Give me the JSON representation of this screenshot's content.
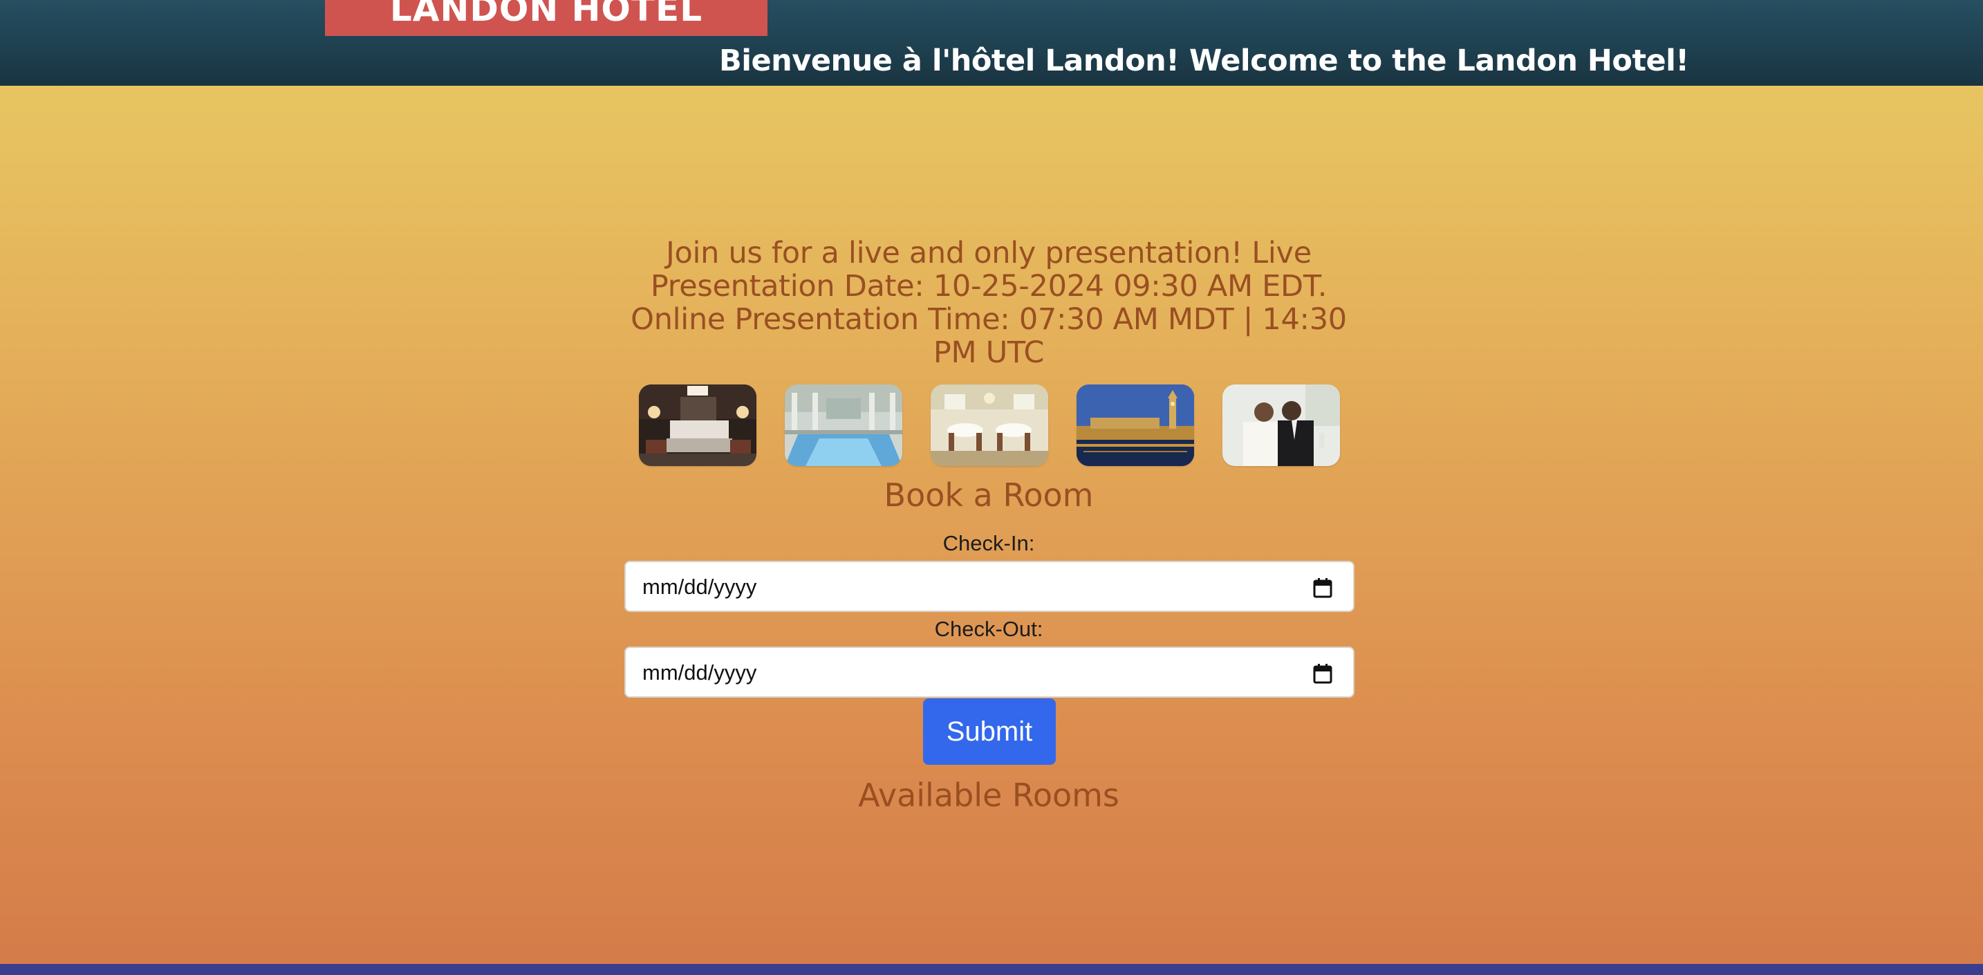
{
  "header": {
    "logo_text": "LANDON HOTEL",
    "welcome": "Bienvenue à l'hôtel Landon! Welcome to the Landon Hotel!"
  },
  "main": {
    "presentation": "Join us for a live and only presentation! Live Presentation Date: 10-25-2024 09:30 AM EDT. Online Presentation Time: 07:30 AM MDT | 14:30 PM UTC",
    "gallery": [
      "bedroom-photo",
      "indoor-pool-photo",
      "dining-room-photo",
      "london-parliament-photo",
      "wedding-couple-photo"
    ],
    "booking": {
      "title": "Book a Room",
      "checkin_label": "Check-In:",
      "checkin_placeholder": "mm/dd/yyyy",
      "checkout_label": "Check-Out:",
      "checkout_placeholder": "mm/dd/yyyy",
      "submit_label": "Submit"
    },
    "available_rooms_title": "Available Rooms"
  },
  "colors": {
    "header_bg": "#1e3f4e",
    "logo_bg": "#cf5450",
    "heading_text": "#9a4f22",
    "submit_bg": "#3368ec",
    "footer_bar": "#3a3e8e"
  }
}
